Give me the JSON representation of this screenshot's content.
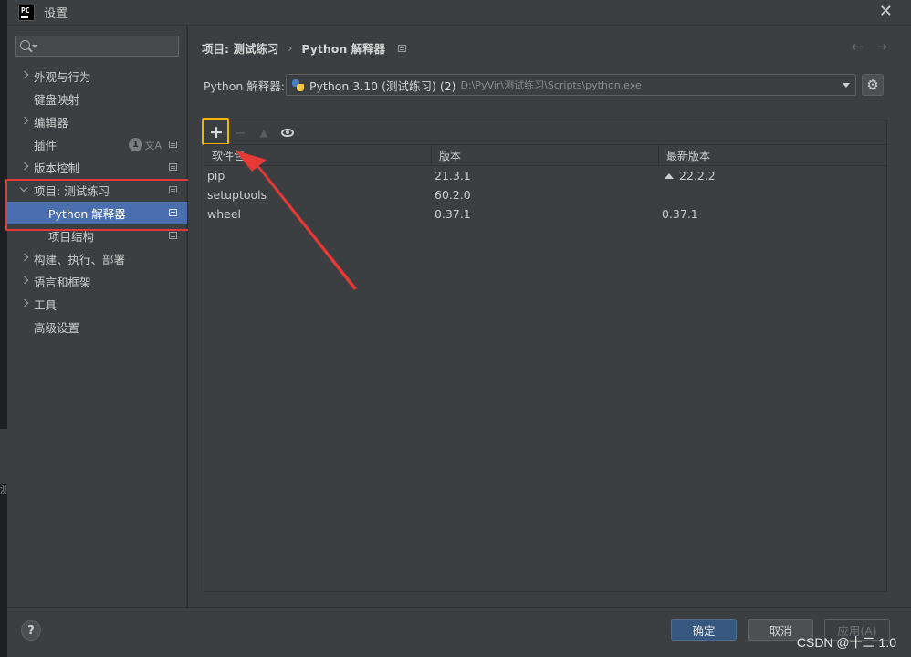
{
  "window": {
    "logo_text": "PC",
    "title": "设置",
    "close_label": "✕"
  },
  "sidebar": {
    "search_placeholder": "",
    "items": [
      {
        "label": "外观与行为",
        "arrow": "right",
        "child": false,
        "selected": false,
        "proj_icon": false
      },
      {
        "label": "键盘映射",
        "arrow": "",
        "child": false,
        "selected": false,
        "proj_icon": false
      },
      {
        "label": "编辑器",
        "arrow": "right",
        "child": false,
        "selected": false,
        "proj_icon": false
      },
      {
        "label": "插件",
        "arrow": "",
        "child": false,
        "selected": false,
        "proj_icon": true,
        "badge": "1"
      },
      {
        "label": "版本控制",
        "arrow": "right",
        "child": false,
        "selected": false,
        "proj_icon": true
      },
      {
        "label": "项目: 测试练习",
        "arrow": "down",
        "child": false,
        "selected": false,
        "proj_icon": true
      },
      {
        "label": "Python 解释器",
        "arrow": "",
        "child": true,
        "selected": true,
        "proj_icon": true
      },
      {
        "label": "项目结构",
        "arrow": "",
        "child": true,
        "selected": false,
        "proj_icon": true
      },
      {
        "label": "构建、执行、部署",
        "arrow": "right",
        "child": false,
        "selected": false,
        "proj_icon": false
      },
      {
        "label": "语言和框架",
        "arrow": "right",
        "child": false,
        "selected": false,
        "proj_icon": false
      },
      {
        "label": "工具",
        "arrow": "right",
        "child": false,
        "selected": false,
        "proj_icon": false
      },
      {
        "label": "高级设置",
        "arrow": "",
        "child": false,
        "selected": false,
        "proj_icon": false
      }
    ]
  },
  "main": {
    "breadcrumb": {
      "parent": "项目: 测试练习",
      "separator": "›",
      "current": "Python 解释器"
    },
    "nav_back": "←",
    "nav_forward": "→",
    "interpreter": {
      "label": "Python 解释器:",
      "name": "Python 3.10 (测试练习) (2)",
      "path": "D:\\PyVir\\测试练习\\Scripts\\python.exe"
    },
    "toolbar": {
      "add": "+",
      "remove": "−",
      "upgrade": "▲"
    },
    "table": {
      "headers": [
        "软件包",
        "版本",
        "最新版本"
      ],
      "rows": [
        {
          "package": "pip",
          "version": "21.3.1",
          "latest": "22.2.2",
          "upgrade": true
        },
        {
          "package": "setuptools",
          "version": "60.2.0",
          "latest": "",
          "upgrade": false
        },
        {
          "package": "wheel",
          "version": "0.37.1",
          "latest": "0.37.1",
          "upgrade": false
        }
      ]
    }
  },
  "footer": {
    "help": "?",
    "ok": "确定",
    "cancel": "取消",
    "apply": "应用(A)"
  },
  "watermark": "CSDN @十二 1.0",
  "backdrop_char": "测",
  "colors": {
    "selected": "#4b6eaf",
    "highlight_red": "#e53935",
    "highlight_yellow": "#f5b400",
    "ok_button": "#365880"
  }
}
